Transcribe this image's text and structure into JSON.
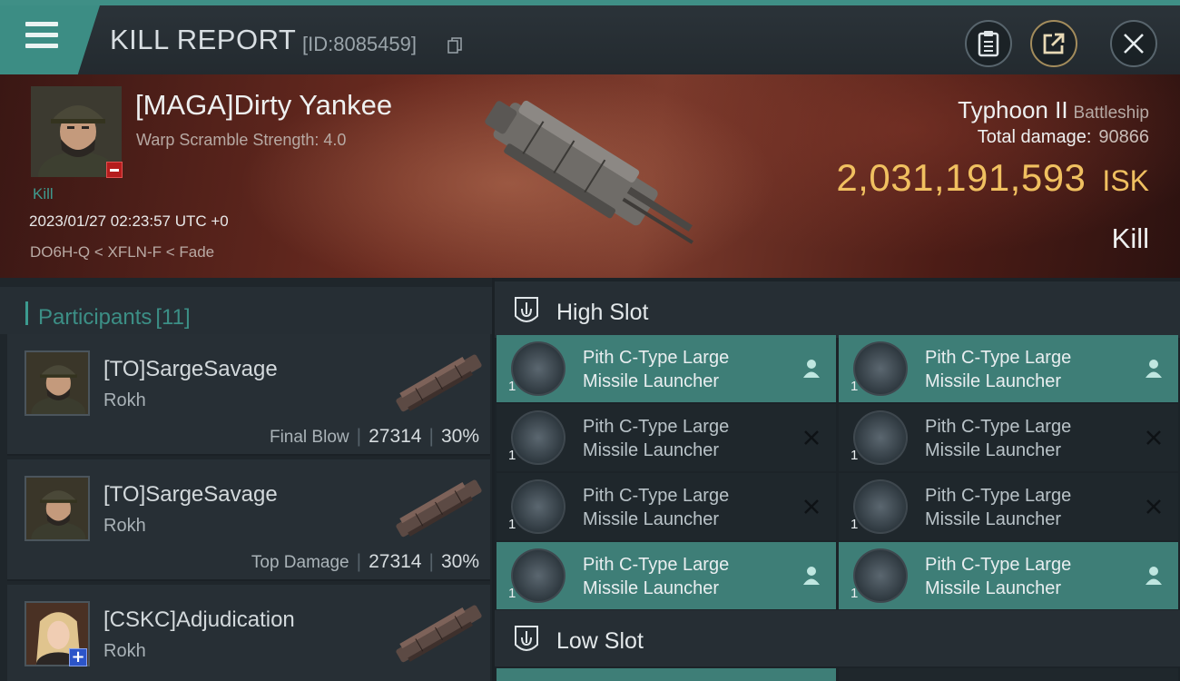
{
  "header": {
    "title": "KILL REPORT",
    "report_id": "[ID:8085459]"
  },
  "victim": {
    "name": "[MAGA]Dirty Yankee",
    "warp_scramble": "Warp Scramble Strength: 4.0",
    "role": "Kill",
    "timestamp": "2023/01/27 02:23:57 UTC +0",
    "location": "DO6H-Q < XFLN-F < Fade",
    "ship": "Typhoon II",
    "ship_class": "Battleship",
    "total_damage_label": "Total damage:",
    "total_damage": "90866",
    "isk_value": "2,031,191,593",
    "isk_unit": "ISK",
    "result": "Kill"
  },
  "participants": {
    "title": "Participants",
    "count": "[11]",
    "rows": [
      {
        "name": "[TO]SargeSavage",
        "ship": "Rokh",
        "tag": "Final Blow",
        "damage": "27314",
        "percent": "30%"
      },
      {
        "name": "[TO]SargeSavage",
        "ship": "Rokh",
        "tag": "Top Damage",
        "damage": "27314",
        "percent": "30%"
      },
      {
        "name": "[CSKC]Adjudication",
        "ship": "Rokh",
        "tag": "",
        "damage": "",
        "percent": ""
      }
    ]
  },
  "fitting": {
    "high_slot_title": "High Slot",
    "low_slot_title": "Low Slot",
    "modules": [
      {
        "line1": "Pith C-Type Large",
        "line2": "Missile Launcher",
        "qty": "1",
        "status": "dropped"
      },
      {
        "line1": "Pith C-Type Large",
        "line2": "Missile Launcher",
        "qty": "1",
        "status": "dropped"
      },
      {
        "line1": "Pith C-Type Large",
        "line2": "Missile Launcher",
        "qty": "1",
        "status": "destroyed"
      },
      {
        "line1": "Pith C-Type Large",
        "line2": "Missile Launcher",
        "qty": "1",
        "status": "destroyed"
      },
      {
        "line1": "Pith C-Type Large",
        "line2": "Missile Launcher",
        "qty": "1",
        "status": "destroyed"
      },
      {
        "line1": "Pith C-Type Large",
        "line2": "Missile Launcher",
        "qty": "1",
        "status": "destroyed"
      },
      {
        "line1": "Pith C-Type Large",
        "line2": "Missile Launcher",
        "qty": "1",
        "status": "dropped"
      },
      {
        "line1": "Pith C-Type Large",
        "line2": "Missile Launcher",
        "qty": "1",
        "status": "dropped"
      }
    ]
  },
  "colors": {
    "accent_teal": "#3c8d84",
    "isk_gold": "#f0c060",
    "kill_red": "#6b2b20"
  }
}
